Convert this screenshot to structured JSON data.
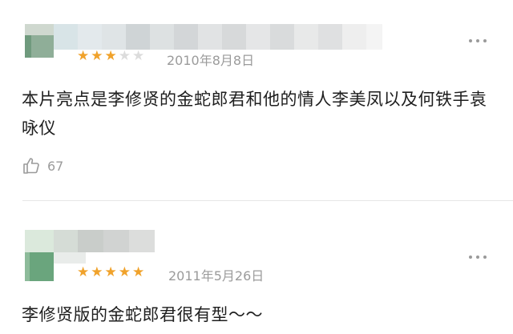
{
  "reviews": [
    {
      "rating": 3,
      "max_rating": 5,
      "date": "2010年8月8日",
      "content": "本片亮点是李修贤的金蛇郎君和他的情人李美凤以及何铁手袁咏仪",
      "likes": "67",
      "icons": {
        "like": "thumbs-up-icon",
        "more": "more-dots-icon"
      }
    },
    {
      "rating": 5,
      "max_rating": 5,
      "date": "2011年5月26日",
      "content": "李修贤版的金蛇郎君很有型～～",
      "icons": {
        "more": "more-dots-icon"
      }
    }
  ],
  "colors": {
    "star_on": "#f0a22b",
    "star_off": "#dcdcdc",
    "meta_text": "#9b9b9b"
  }
}
